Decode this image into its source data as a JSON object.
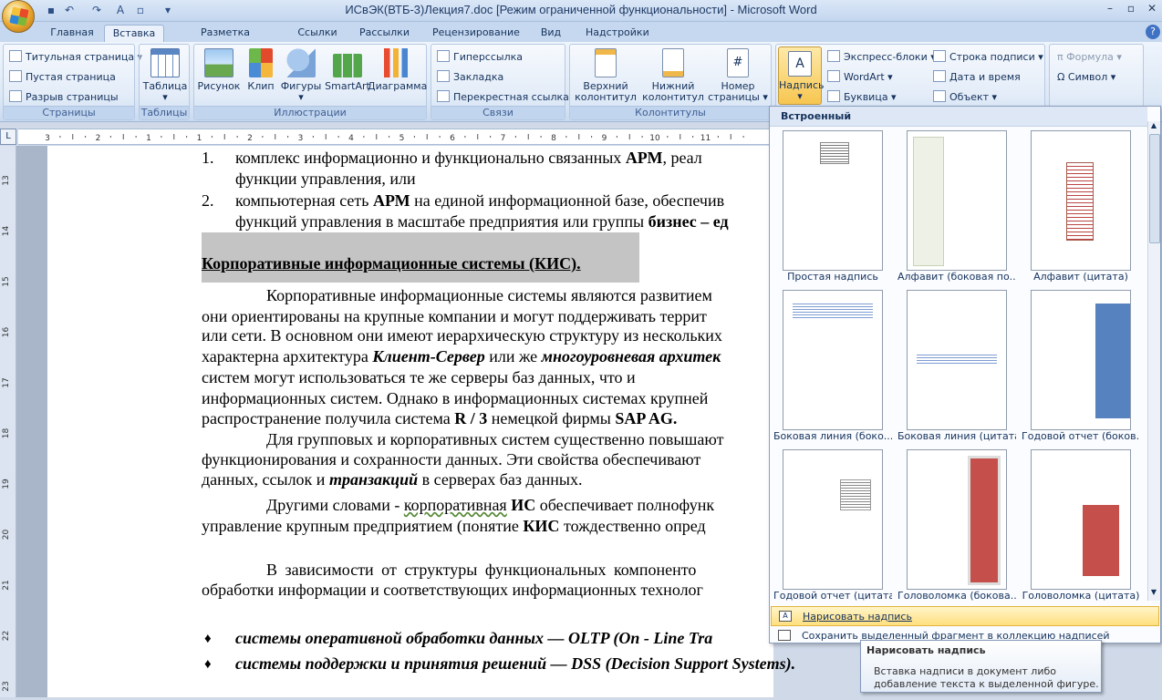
{
  "window": {
    "title": "ИСвЭК(ВТБ-3)Лекция7.doc [Режим ограниченной функциональности]  -  Microsoft Word"
  },
  "tabs": [
    "Главная",
    "Вставка",
    "Разметка страницы",
    "Ссылки",
    "Рассылки",
    "Рецензирование",
    "Вид",
    "Надстройки"
  ],
  "ribbon": {
    "pages": {
      "label": "Страницы",
      "items": [
        "Титульная страница",
        "Пустая страница",
        "Разрыв страницы"
      ]
    },
    "tables": {
      "label": "Таблицы",
      "item": "Таблица"
    },
    "illustrations": {
      "label": "Иллюстрации",
      "items": [
        "Рисунок",
        "Клип",
        "Фигуры",
        "SmartArt",
        "Диаграмма"
      ]
    },
    "links": {
      "label": "Связи",
      "items": [
        "Гиперссылка",
        "Закладка",
        "Перекрестная ссылка"
      ]
    },
    "headers": {
      "label": "Колонтитулы",
      "items": [
        [
          "Верхний",
          "колонтитул"
        ],
        [
          "Нижний",
          "колонтитул"
        ],
        [
          "Номер",
          "страницы"
        ]
      ]
    },
    "text": {
      "textbox": "Надпись",
      "items": [
        "Экспресс-блоки",
        "WordArt",
        "Буквица",
        "Строка подписи",
        "Дата и время",
        "Объект"
      ]
    },
    "symbols": {
      "items": [
        "Формула",
        "Символ"
      ]
    }
  },
  "document": {
    "li1_num": "1.",
    "li1_a": "комплекс информационно и функционально связанных ",
    "li1_bold": "АРМ",
    ", ": "",
    "li1_b": ", реал",
    "li1_c": "функции управления, или",
    "li2_num": "2.",
    "li2_a": "компьютерная сеть ",
    "li2_bold": "АРМ",
    "li2_b": " на единой информационной базе, обеспечив",
    "li2_c": "функций управления в масштабе предприятия или группы ",
    "li2_bold2": "бизнес – ед",
    "heading": "Корпоративные информационные системы (КИС).",
    "p1": "Корпоративные информационные системы являются развитием",
    "p1_2": "они ориентированы на крупные компании и могут поддерживать террит",
    "p1_3": "или сети. В основном они имеют иерархическую структуру из нескольких",
    "p1_4a": "характерна архитектура ",
    "p1_4b": "Клиент-Сервер",
    "p1_4c": " или же ",
    "p1_4d": "многоуровневая архитек",
    "p1_5": "систем могут использоваться те же серверы баз данных, что и",
    "p1_6": "информационных систем. Однако в информационных системах крупней",
    "p1_7a": "распространение получила система ",
    "p1_7b": "R / 3",
    "p1_7c": "    немецкой фирмы ",
    "p1_7d": "SAP AG.",
    "p2": "Для групповых и корпоративных систем существенно повышают",
    "p2_2": "функционирования и сохранности данных. Эти свойства обеспечивают",
    "p2_3a": "данных, ссылок и ",
    "p2_3b": "транзакций",
    "p2_3c": " в серверах баз данных.",
    "p3a": "Другими словами  - ",
    "p3b": "корпоративная",
    "p3c": " ИС",
    " p3d": "",
    "p3e": " обеспечивает полнофунк",
    "p3_2a": "управление крупным предприятием (понятие ",
    "p3_2b": "КИС",
    "p3_2c": " тождественно опред",
    "p4": "В   зависимости   от   структуры   функциональных   компоненто",
    "p4_2": "обработки информации и соответствующих информационных технолог",
    "b1": "системы оперативной обработки данных — OLTP (On - Line Tra",
    "b2": "системы поддержки и принятия решений — DSS (Decision Support Systems).",
    "bullet": "♦"
  },
  "gallery": {
    "header": "Встроенный",
    "items": [
      "Простая надпись",
      "Алфавит (боковая по...",
      "Алфавит (цитата)",
      "Боковая линия (боко...",
      "Боковая линия (цитата)",
      "Годовой отчет (боков...",
      "Годовой отчет (цитата)",
      "Головоломка (бокова...",
      "Головоломка (цитата)"
    ],
    "draw": "Нарисовать надпись",
    "save": "Сохранить выделенный фрагмент в коллекцию надписей"
  },
  "tooltip": {
    "title": "Нарисовать надпись",
    "body1": "Вставка надписи в документ либо",
    "body2": "добавление текста к выделенной фигуре."
  },
  "ruler": {
    "hmarks": [
      "3",
      "2",
      "1",
      "1",
      "2",
      "3",
      "4",
      "5",
      "6",
      "7",
      "8",
      "9",
      "10",
      "11"
    ],
    "vmarks": [
      "13",
      "14",
      "15",
      "16",
      "17",
      "18",
      "19",
      "20",
      "21",
      "22",
      "23"
    ]
  }
}
